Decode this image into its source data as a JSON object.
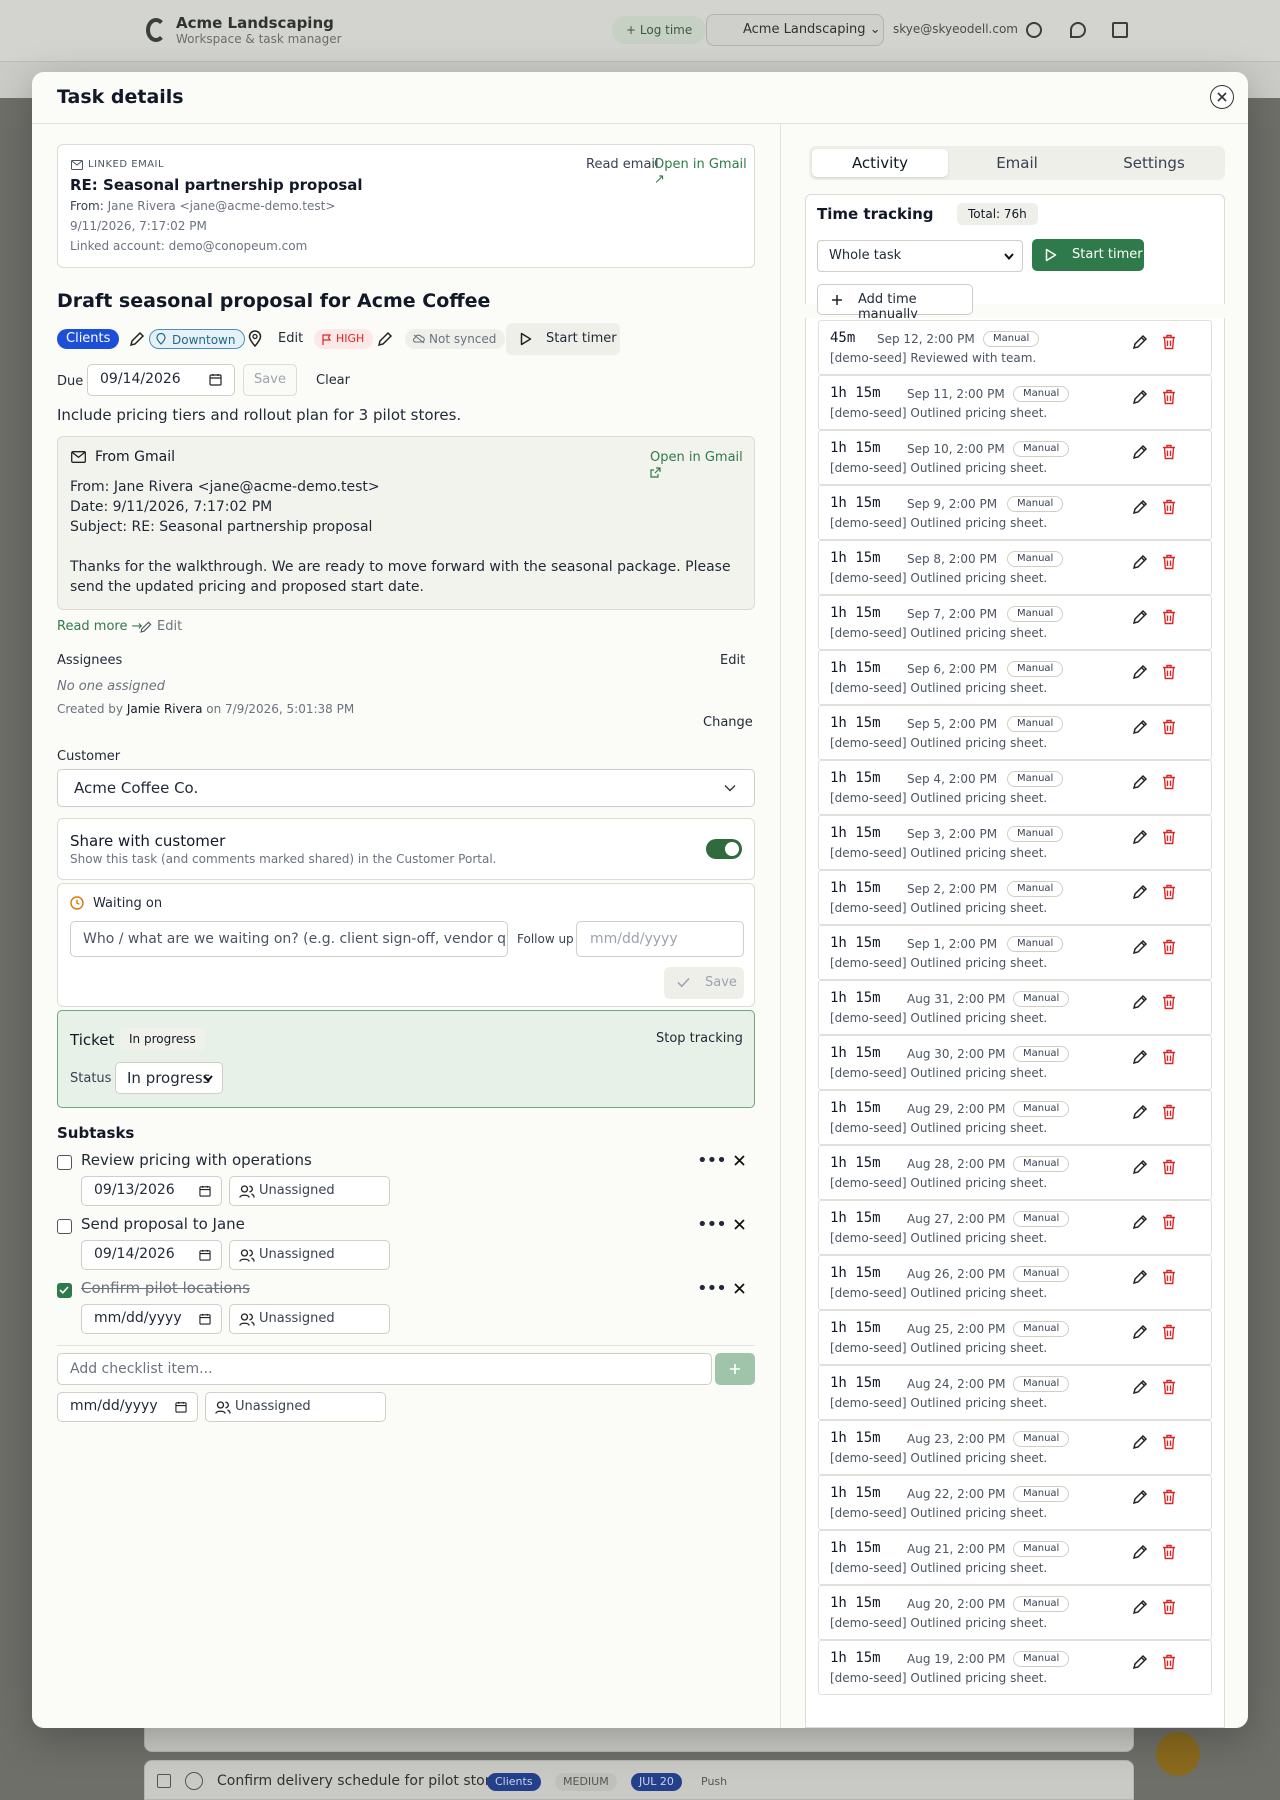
{
  "background": {
    "brand_name": "Acme Landscaping",
    "brand_tagline": "Workspace & task manager",
    "log_time_label": "Log time",
    "workspace_name": "Acme Landscaping",
    "user_email": "skye@skyeodell.com",
    "row_task": "Confirm delivery schedule for pilot stores",
    "row_tag": "Clients",
    "row_priority": "MEDIUM",
    "row_date": "JUL 20",
    "row_push": "Push"
  },
  "modal": {
    "title": "Task details"
  },
  "linked_email": {
    "label": "LINKED EMAIL",
    "subject": "RE: Seasonal partnership proposal",
    "from_label": "From:",
    "from_value": "Jane Rivera <jane@acme-demo.test>",
    "date": "9/11/2026, 7:17:02 PM",
    "account": "Linked account: demo@conopeum.com",
    "read_email_label": "Read email",
    "open_gmail_label": "Open in Gmail ↗"
  },
  "task": {
    "title": "Draft seasonal proposal for Acme Coffee",
    "tag": "Clients",
    "location": "Downtown",
    "location_edit_label": "Edit",
    "priority": "HIGH",
    "sync_status": "Not synced",
    "start_timer_label": "Start timer",
    "due_label": "Due",
    "due_value": "09/14/2026",
    "save_label": "Save",
    "clear_label": "Clear",
    "description": "Include pricing tiers and rollout plan for 3 pilot stores."
  },
  "gmail_box": {
    "title": "From Gmail",
    "open_label": "Open in Gmail",
    "from_line": "From: Jane Rivera <jane@acme-demo.test>",
    "date_line": "Date: 9/11/2026, 7:17:02 PM",
    "subject_line": "Subject: RE: Seasonal partnership proposal",
    "body": "Thanks for the walkthrough. We are ready to move forward with the seasonal package. Please send the updated pricing and proposed start date.",
    "read_more_label": "Read more →",
    "edit_label": "Edit"
  },
  "assignees": {
    "label": "Assignees",
    "edit_label": "Edit",
    "empty_text": "No one assigned",
    "created_prefix": "Created by",
    "created_by": "Jamie Rivera",
    "created_suffix": "on 7/9/2026, 5:01:38 PM",
    "change_label": "Change"
  },
  "customer": {
    "label": "Customer",
    "value": "Acme Coffee Co."
  },
  "share": {
    "title": "Share with customer",
    "desc": "Show this task (and comments marked shared) in the Customer Portal.",
    "enabled": true
  },
  "waiting": {
    "title": "Waiting on",
    "placeholder": "Who / what are we waiting on? (e.g. client sign-off, vendor quote)",
    "follow_up_label": "Follow up",
    "follow_up_placeholder": "mm/dd/yyyy",
    "save_label": "Save"
  },
  "ticket": {
    "title": "Ticket",
    "badge": "In progress",
    "stop_label": "Stop tracking",
    "status_label": "Status",
    "status_value": "In progress"
  },
  "subtasks": {
    "title": "Subtasks",
    "items": [
      {
        "label": "Review pricing with operations",
        "date": "09/13/2026",
        "assignee": "Unassigned",
        "done": false
      },
      {
        "label": "Send proposal to Jane",
        "date": "09/14/2026",
        "assignee": "Unassigned",
        "done": false
      },
      {
        "label": "Confirm pilot locations",
        "date": "mm/dd/yyyy",
        "assignee": "Unassigned",
        "done": true
      }
    ],
    "add_placeholder": "Add checklist item...",
    "add_date_placeholder": "mm/dd/yyyy",
    "add_assignee": "Unassigned"
  },
  "right": {
    "tabs": [
      "Activity",
      "Email",
      "Settings"
    ],
    "time_tracking_title": "Time tracking",
    "total_label": "Total: 76h",
    "scope_select": "Whole task",
    "start_timer_label": "Start timer",
    "add_manual_label": "Add time manually",
    "entries": [
      {
        "duration": "45m",
        "when": "Sep 12, 2:00 PM",
        "tag": "Manual",
        "note": "[demo-seed] Reviewed with team."
      },
      {
        "duration": "1h 15m",
        "when": "Sep 11, 2:00 PM",
        "tag": "Manual",
        "note": "[demo-seed] Outlined pricing sheet."
      },
      {
        "duration": "1h 15m",
        "when": "Sep 10, 2:00 PM",
        "tag": "Manual",
        "note": "[demo-seed] Outlined pricing sheet."
      },
      {
        "duration": "1h 15m",
        "when": "Sep 9, 2:00 PM",
        "tag": "Manual",
        "note": "[demo-seed] Outlined pricing sheet."
      },
      {
        "duration": "1h 15m",
        "when": "Sep 8, 2:00 PM",
        "tag": "Manual",
        "note": "[demo-seed] Outlined pricing sheet."
      },
      {
        "duration": "1h 15m",
        "when": "Sep 7, 2:00 PM",
        "tag": "Manual",
        "note": "[demo-seed] Outlined pricing sheet."
      },
      {
        "duration": "1h 15m",
        "when": "Sep 6, 2:00 PM",
        "tag": "Manual",
        "note": "[demo-seed] Outlined pricing sheet."
      },
      {
        "duration": "1h 15m",
        "when": "Sep 5, 2:00 PM",
        "tag": "Manual",
        "note": "[demo-seed] Outlined pricing sheet."
      },
      {
        "duration": "1h 15m",
        "when": "Sep 4, 2:00 PM",
        "tag": "Manual",
        "note": "[demo-seed] Outlined pricing sheet."
      },
      {
        "duration": "1h 15m",
        "when": "Sep 3, 2:00 PM",
        "tag": "Manual",
        "note": "[demo-seed] Outlined pricing sheet."
      },
      {
        "duration": "1h 15m",
        "when": "Sep 2, 2:00 PM",
        "tag": "Manual",
        "note": "[demo-seed] Outlined pricing sheet."
      },
      {
        "duration": "1h 15m",
        "when": "Sep 1, 2:00 PM",
        "tag": "Manual",
        "note": "[demo-seed] Outlined pricing sheet."
      },
      {
        "duration": "1h 15m",
        "when": "Aug 31, 2:00 PM",
        "tag": "Manual",
        "note": "[demo-seed] Outlined pricing sheet."
      },
      {
        "duration": "1h 15m",
        "when": "Aug 30, 2:00 PM",
        "tag": "Manual",
        "note": "[demo-seed] Outlined pricing sheet."
      },
      {
        "duration": "1h 15m",
        "when": "Aug 29, 2:00 PM",
        "tag": "Manual",
        "note": "[demo-seed] Outlined pricing sheet."
      },
      {
        "duration": "1h 15m",
        "when": "Aug 28, 2:00 PM",
        "tag": "Manual",
        "note": "[demo-seed] Outlined pricing sheet."
      },
      {
        "duration": "1h 15m",
        "when": "Aug 27, 2:00 PM",
        "tag": "Manual",
        "note": "[demo-seed] Outlined pricing sheet."
      },
      {
        "duration": "1h 15m",
        "when": "Aug 26, 2:00 PM",
        "tag": "Manual",
        "note": "[demo-seed] Outlined pricing sheet."
      },
      {
        "duration": "1h 15m",
        "when": "Aug 25, 2:00 PM",
        "tag": "Manual",
        "note": "[demo-seed] Outlined pricing sheet."
      },
      {
        "duration": "1h 15m",
        "when": "Aug 24, 2:00 PM",
        "tag": "Manual",
        "note": "[demo-seed] Outlined pricing sheet."
      },
      {
        "duration": "1h 15m",
        "when": "Aug 23, 2:00 PM",
        "tag": "Manual",
        "note": "[demo-seed] Outlined pricing sheet."
      },
      {
        "duration": "1h 15m",
        "when": "Aug 22, 2:00 PM",
        "tag": "Manual",
        "note": "[demo-seed] Outlined pricing sheet."
      },
      {
        "duration": "1h 15m",
        "when": "Aug 21, 2:00 PM",
        "tag": "Manual",
        "note": "[demo-seed] Outlined pricing sheet."
      },
      {
        "duration": "1h 15m",
        "when": "Aug 20, 2:00 PM",
        "tag": "Manual",
        "note": "[demo-seed] Outlined pricing sheet."
      },
      {
        "duration": "1h 15m",
        "when": "Aug 19, 2:00 PM",
        "tag": "Manual",
        "note": "[demo-seed] Outlined pricing sheet."
      }
    ]
  },
  "colors": {
    "accent_green": "#2f7a4a",
    "clients_blue": "#1d4ed8",
    "priority_red": "#dc2626",
    "ticket_bg": "#e8f1e8"
  }
}
